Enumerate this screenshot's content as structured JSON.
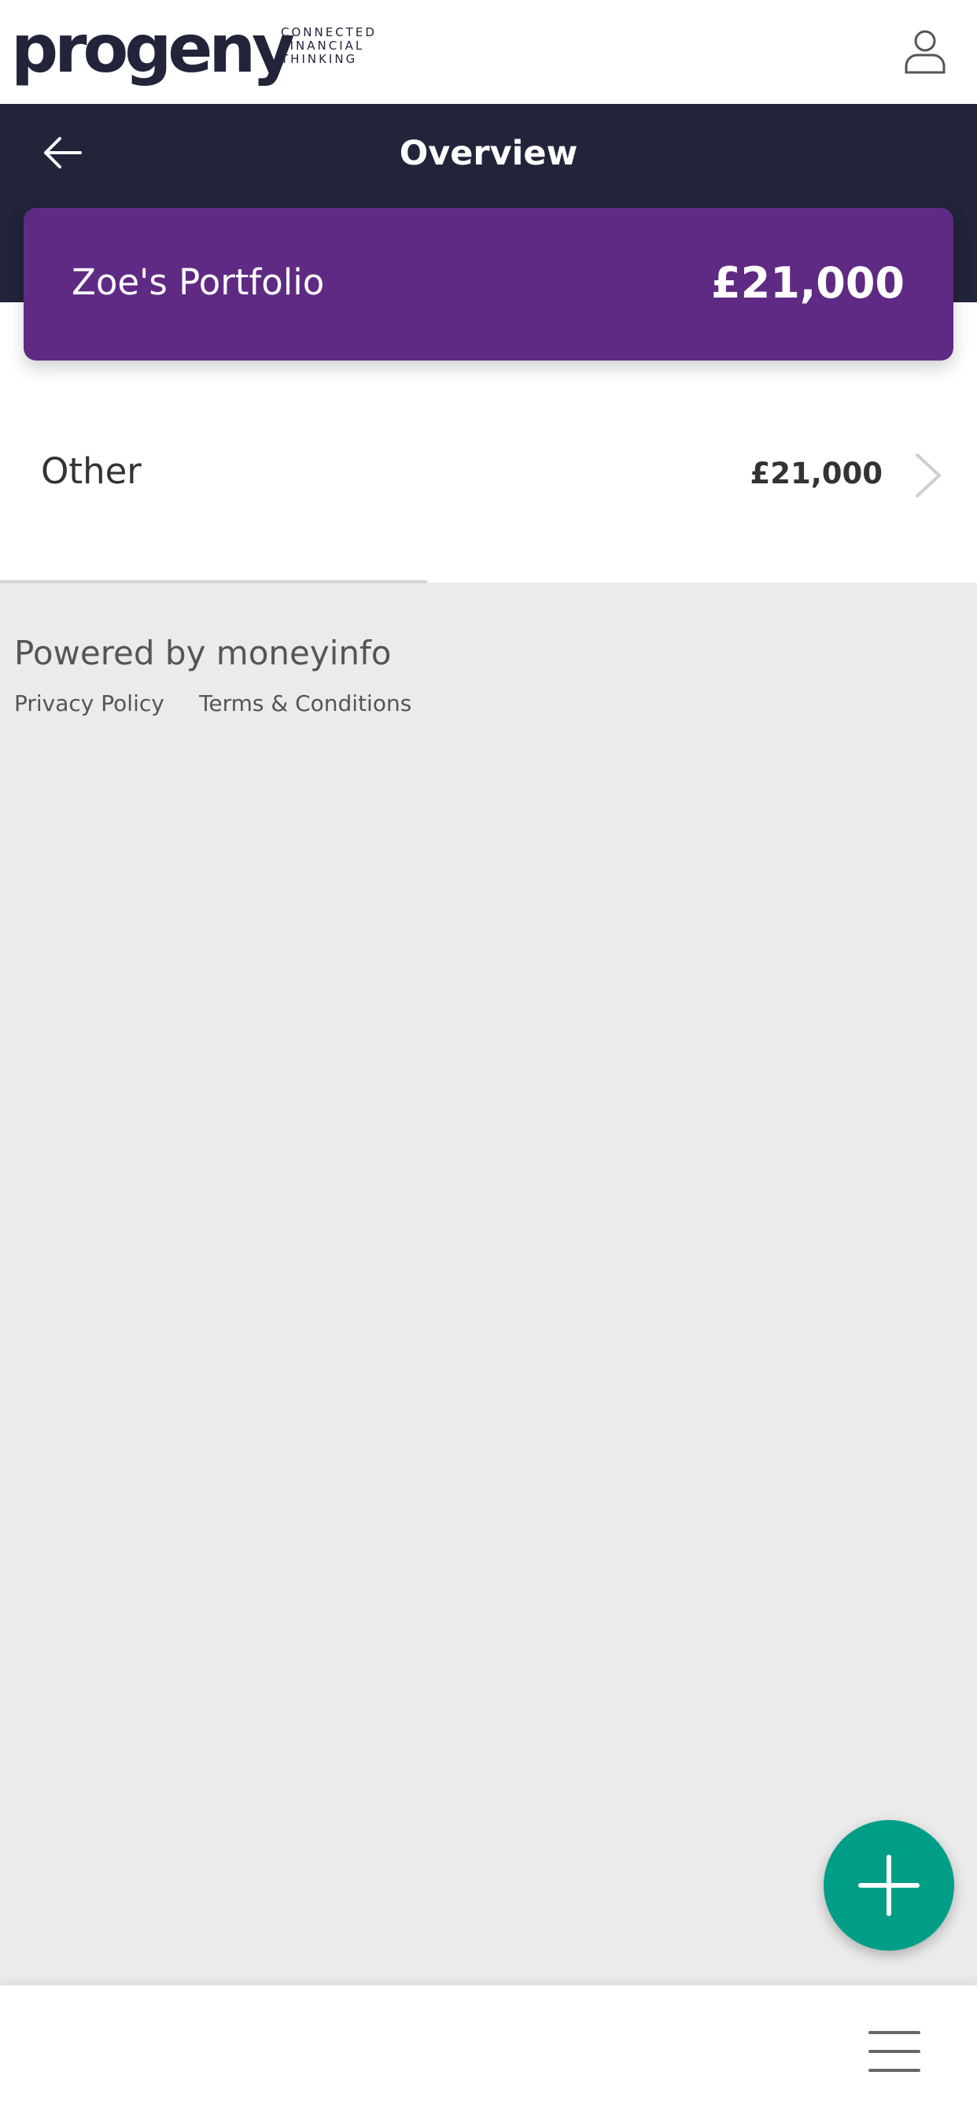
{
  "brand": {
    "logo_text": "progeny",
    "tagline": [
      "CONNECTED",
      "FINANCIAL",
      "THINKING"
    ]
  },
  "header": {
    "title": "Overview"
  },
  "portfolio": {
    "name": "Zoe's Portfolio",
    "value": "£21,000"
  },
  "categories": [
    {
      "label": "Other",
      "value": "£21,000"
    }
  ],
  "footer": {
    "powered_by": "Powered by moneyinfo",
    "links": [
      "Privacy Policy",
      "Terms & Conditions"
    ]
  },
  "icons": {
    "profile": "user-icon",
    "back": "arrow-left-icon",
    "chevron": "chevron-right-icon",
    "add": "plus-icon",
    "menu": "hamburger-menu-icon"
  },
  "colors": {
    "header_bg": "#22243a",
    "card_bg": "#5f2a83",
    "fab_bg": "#009e87",
    "page_bg": "#ebebeb"
  }
}
